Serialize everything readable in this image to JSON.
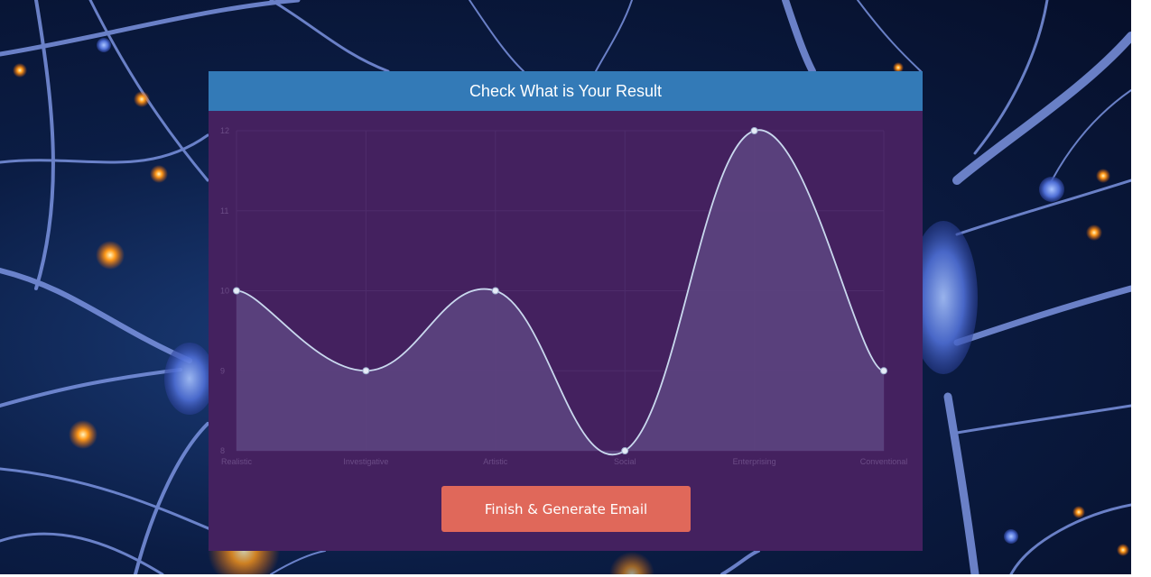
{
  "card": {
    "title": "Check What is Your Result",
    "button_label": "Finish & Generate Email"
  },
  "colors": {
    "header": "#337ab7",
    "card_bg": "#44215f",
    "button": "#e0685a",
    "line": "#c9d8ee",
    "fill": "#5c4480"
  },
  "chart_data": {
    "type": "line",
    "smooth": true,
    "filled": true,
    "title": "",
    "xlabel": "",
    "ylabel": "",
    "categories": [
      "Realistic",
      "Investigative",
      "Artistic",
      "Social",
      "Enterprising",
      "Conventional"
    ],
    "values": [
      10,
      9,
      10,
      8,
      12,
      9
    ],
    "ylim": [
      8,
      12
    ],
    "yticks": [
      "8",
      "9",
      "10",
      "11",
      "12"
    ],
    "grid": true
  }
}
